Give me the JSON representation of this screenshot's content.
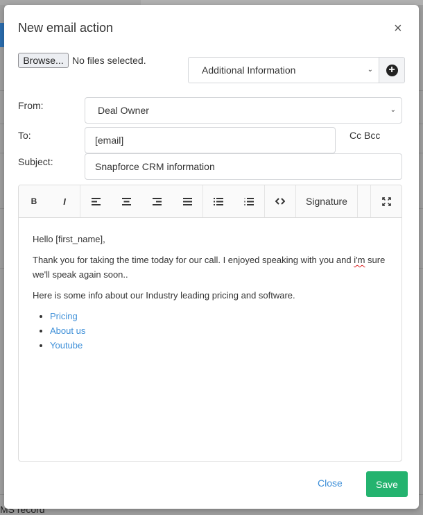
{
  "background": {
    "footer_text": "MS record"
  },
  "modal": {
    "title": "New email action",
    "close_icon": "close-icon"
  },
  "attachment": {
    "browse_label": "Browse...",
    "status": "No files selected."
  },
  "merge_field": {
    "selected": "Additional Information",
    "add_icon": "plus-circle-icon"
  },
  "form": {
    "from_label": "From:",
    "from_value": "Deal Owner",
    "to_label": "To:",
    "to_value": "[email]",
    "cc_label": "Cc",
    "bcc_label": "Bcc",
    "subject_label": "Subject:",
    "subject_value": "Snapforce CRM information"
  },
  "toolbar": {
    "bold": "B",
    "italic": "I",
    "signature": "Signature",
    "icons": [
      "bold-icon",
      "italic-icon",
      "align-left-icon",
      "align-center-icon",
      "align-right-icon",
      "align-justify-icon",
      "unordered-list-icon",
      "ordered-list-icon",
      "code-view-icon",
      "fullscreen-icon"
    ]
  },
  "body": {
    "greeting": "Hello [first_name],",
    "para1_a": "Thank you for taking the time today for our call. I enjoyed speaking with you and ",
    "para1_misspelled": "i'm",
    "para1_b": " sure we'll speak again soon..",
    "para2": "Here is some info about our Industry leading pricing and software.",
    "links": [
      "Pricing",
      "About us",
      "Youtube"
    ]
  },
  "footer": {
    "close_label": "Close",
    "save_label": "Save"
  },
  "colors": {
    "link": "#3d8fd8",
    "save": "#24b36f"
  }
}
